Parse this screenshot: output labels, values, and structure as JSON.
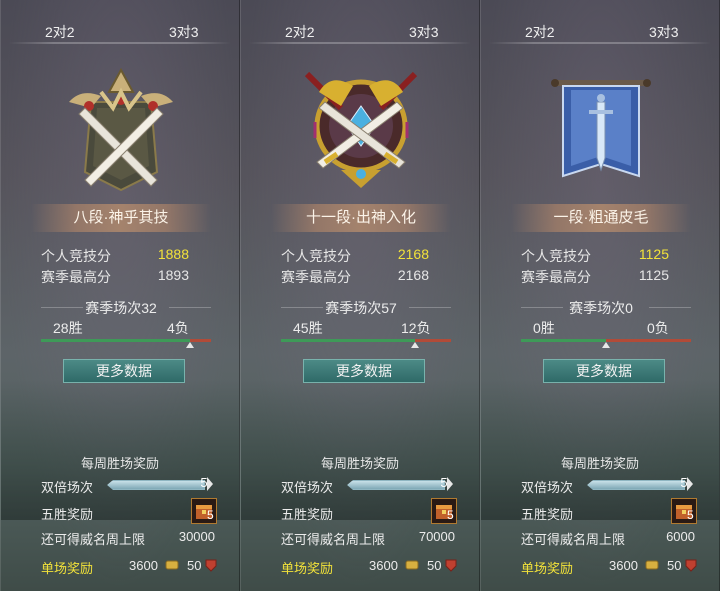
{
  "panels": [
    {
      "tabs": [
        "2对2",
        "3对3"
      ],
      "emblem": "swords-rank-emblem-icon",
      "rank_title": "八段·神乎其技",
      "personal_score_label": "个人竞技分",
      "personal_score": "1888",
      "season_high_label": "赛季最高分",
      "season_high": "1893",
      "season_matches": "赛季场次32",
      "wins": "28胜",
      "losses": "4负",
      "win_fraction": 0.875,
      "more_data": "更多数据",
      "weekly_title": "每周胜场奖励",
      "double_label": "双倍场次",
      "double_count": "5",
      "five_win_label": "五胜奖励",
      "chest_count": "5",
      "limit_label": "还可得威名周上限",
      "limit_value": "30000",
      "single_reward_label": "单场奖励",
      "coin_value": "3600",
      "badge_value": "50"
    },
    {
      "tabs": [
        "2对2",
        "3对3"
      ],
      "emblem": "ornate-swords-rank-emblem-icon",
      "rank_title": "十一段·出神入化",
      "personal_score_label": "个人竞技分",
      "personal_score": "2168",
      "season_high_label": "赛季最高分",
      "season_high": "2168",
      "season_matches": "赛季场次57",
      "wins": "45胜",
      "losses": "12负",
      "win_fraction": 0.79,
      "more_data": "更多数据",
      "weekly_title": "每周胜场奖励",
      "double_label": "双倍场次",
      "double_count": "5",
      "five_win_label": "五胜奖励",
      "chest_count": "5",
      "limit_label": "还可得威名周上限",
      "limit_value": "70000",
      "single_reward_label": "单场奖励",
      "coin_value": "3600",
      "badge_value": "50"
    },
    {
      "tabs": [
        "2对2",
        "3对3"
      ],
      "emblem": "banner-sword-rank-emblem-icon",
      "rank_title": "一段·粗通皮毛",
      "personal_score_label": "个人竞技分",
      "personal_score": "1125",
      "season_high_label": "赛季最高分",
      "season_high": "1125",
      "season_matches": "赛季场次0",
      "wins": "0胜",
      "losses": "0负",
      "win_fraction": 0.5,
      "more_data": "更多数据",
      "weekly_title": "每周胜场奖励",
      "double_label": "双倍场次",
      "double_count": "5",
      "five_win_label": "五胜奖励",
      "chest_count": "5",
      "limit_label": "还可得威名周上限",
      "limit_value": "6000",
      "single_reward_label": "单场奖励",
      "coin_value": "3600",
      "badge_value": "50"
    }
  ],
  "colors": {
    "gold_value": "#f2e23a",
    "win_bar": "#3e9a58",
    "loss_bar": "#b24b38",
    "button": "#2f6a68"
  }
}
